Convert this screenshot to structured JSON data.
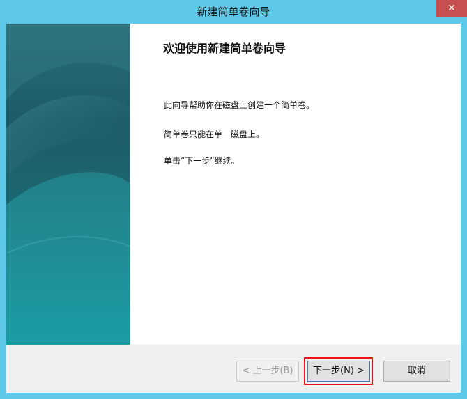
{
  "window": {
    "title": "新建简单卷向导",
    "close_label": "✕"
  },
  "content": {
    "heading": "欢迎使用新建简单卷向导",
    "paragraphs": [
      "此向导帮助你在磁盘上创建一个简单卷。",
      "简单卷只能在单一磁盘上。",
      "单击“下一步”继续。"
    ]
  },
  "buttons": {
    "back": "< 上一步(B)",
    "next": "下一步(N) >",
    "cancel": "取消"
  },
  "colors": {
    "titlebar": "#5ec8e8",
    "banner": "#1d5b66",
    "close_button": "#c75050",
    "highlight": "#e8141c"
  },
  "icons": {
    "close": "close-icon"
  }
}
